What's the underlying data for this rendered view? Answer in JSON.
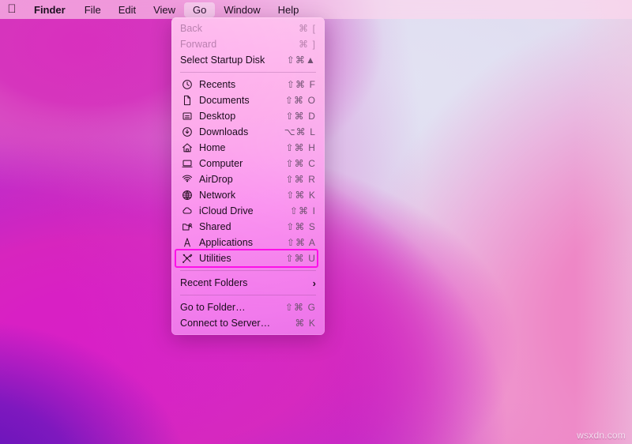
{
  "watermark": "wsxdn.com",
  "accent_colors": {
    "annotation_box": "#fd10e8",
    "menu_tint": "#f9a0ee",
    "menubar_tint": "#ffd6ee",
    "wallpaper_violet": "#7a20cf",
    "wallpaper_magenta": "#d81fc6",
    "wallpaper_light": "#e2e2f3"
  },
  "menubar": {
    "apple_icon": "apple-logo-icon",
    "items": [
      {
        "label": "Finder",
        "bold": true,
        "active": false
      },
      {
        "label": "File",
        "bold": false,
        "active": false
      },
      {
        "label": "Edit",
        "bold": false,
        "active": false
      },
      {
        "label": "View",
        "bold": false,
        "active": false
      },
      {
        "label": "Go",
        "bold": false,
        "active": true
      },
      {
        "label": "Window",
        "bold": false,
        "active": false
      },
      {
        "label": "Help",
        "bold": false,
        "active": false
      }
    ]
  },
  "go_menu": {
    "highlighted_item": "Utilities",
    "groups": [
      {
        "items": [
          {
            "label": "Back",
            "shortcut": "⌘ [",
            "icon": null,
            "disabled": true
          },
          {
            "label": "Forward",
            "shortcut": "⌘ ]",
            "icon": null,
            "disabled": true
          },
          {
            "label": "Select Startup Disk",
            "shortcut": "⇧⌘▲",
            "icon": null,
            "disabled": false
          }
        ]
      },
      {
        "items": [
          {
            "label": "Recents",
            "shortcut": "⇧⌘ F",
            "icon": "clock-icon",
            "disabled": false
          },
          {
            "label": "Documents",
            "shortcut": "⇧⌘ O",
            "icon": "document-icon",
            "disabled": false
          },
          {
            "label": "Desktop",
            "shortcut": "⇧⌘ D",
            "icon": "desktop-icon",
            "disabled": false
          },
          {
            "label": "Downloads",
            "shortcut": "⌥⌘ L",
            "icon": "downloads-icon",
            "disabled": false
          },
          {
            "label": "Home",
            "shortcut": "⇧⌘ H",
            "icon": "home-icon",
            "disabled": false
          },
          {
            "label": "Computer",
            "shortcut": "⇧⌘ C",
            "icon": "computer-icon",
            "disabled": false
          },
          {
            "label": "AirDrop",
            "shortcut": "⇧⌘ R",
            "icon": "airdrop-icon",
            "disabled": false
          },
          {
            "label": "Network",
            "shortcut": "⇧⌘ K",
            "icon": "network-icon",
            "disabled": false
          },
          {
            "label": "iCloud Drive",
            "shortcut": "⇧⌘ I",
            "icon": "cloud-icon",
            "disabled": false
          },
          {
            "label": "Shared",
            "shortcut": "⇧⌘ S",
            "icon": "shared-folder-icon",
            "disabled": false
          },
          {
            "label": "Applications",
            "shortcut": "⇧⌘ A",
            "icon": "applications-icon",
            "disabled": false
          },
          {
            "label": "Utilities",
            "shortcut": "⇧⌘ U",
            "icon": "utilities-icon",
            "disabled": false
          }
        ]
      },
      {
        "items": [
          {
            "label": "Recent Folders",
            "shortcut": null,
            "icon": null,
            "submenu": true,
            "disabled": false
          }
        ]
      },
      {
        "items": [
          {
            "label": "Go to Folder…",
            "shortcut": "⇧⌘ G",
            "icon": null,
            "disabled": false
          },
          {
            "label": "Connect to Server…",
            "shortcut": "⌘ K",
            "icon": null,
            "disabled": false
          }
        ]
      }
    ]
  }
}
